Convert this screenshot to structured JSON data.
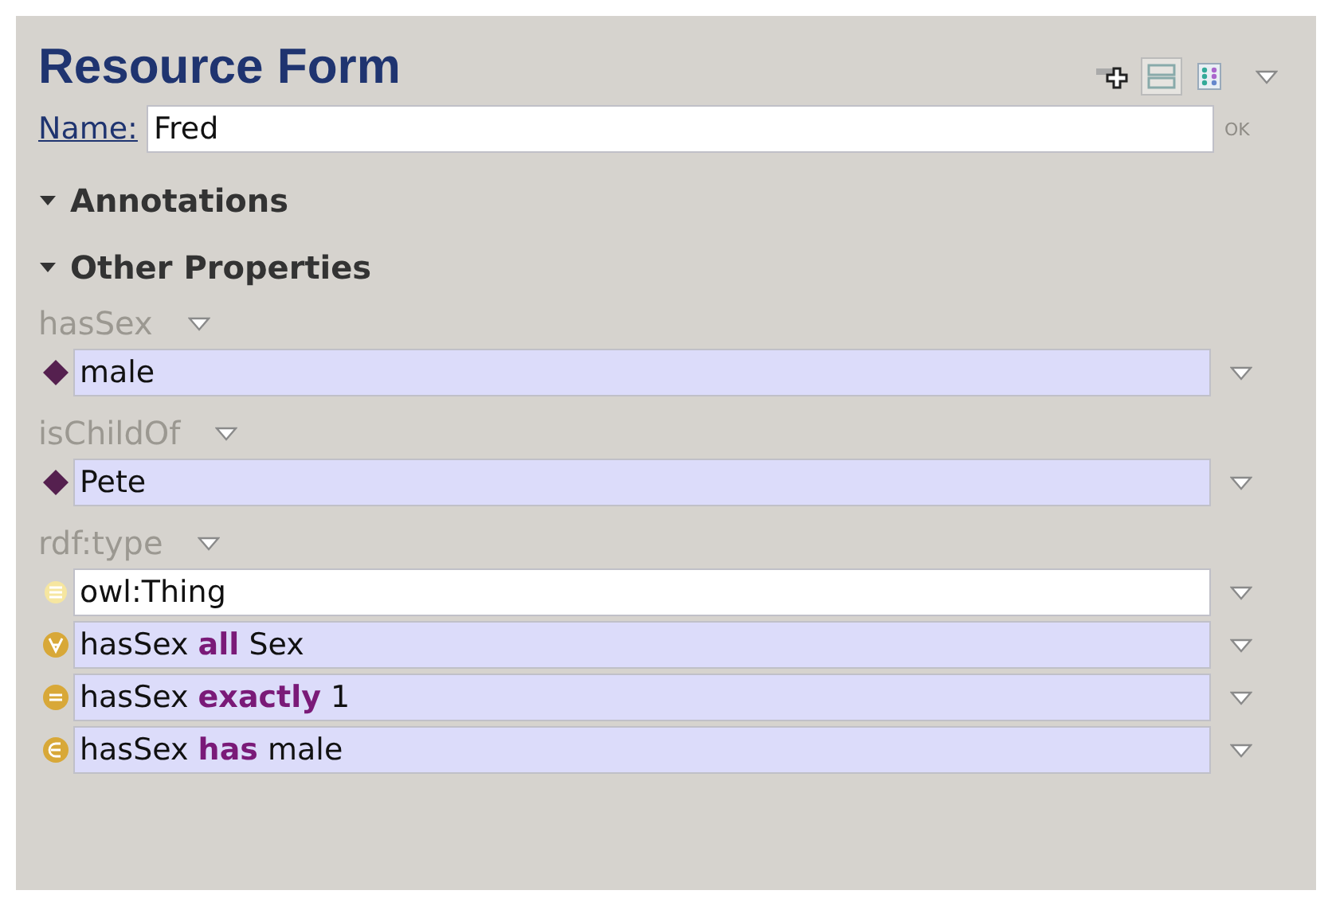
{
  "title": "Resource Form",
  "view_buttons": [
    {
      "kind": "rows",
      "selected": true
    },
    {
      "kind": "grid",
      "selected": false
    }
  ],
  "name_field": {
    "label": "Name:",
    "value": "Fred",
    "ok": "OK"
  },
  "sections": [
    {
      "label": "Annotations",
      "expanded": true
    },
    {
      "label": "Other Properties",
      "expanded": true
    }
  ],
  "properties": [
    {
      "label": "hasSex",
      "values": [
        {
          "kind": "individual",
          "text": "male"
        }
      ]
    },
    {
      "label": "isChildOf",
      "values": [
        {
          "kind": "individual",
          "text": "Pete"
        }
      ]
    },
    {
      "label": "rdf:type",
      "values": [
        {
          "kind": "class",
          "text": "owl:Thing"
        },
        {
          "kind": "all",
          "text": "hasSex **all** Sex"
        },
        {
          "kind": "exactly",
          "text": "hasSex **exactly** 1"
        },
        {
          "kind": "has",
          "text": "hasSex **has** male"
        }
      ]
    }
  ]
}
